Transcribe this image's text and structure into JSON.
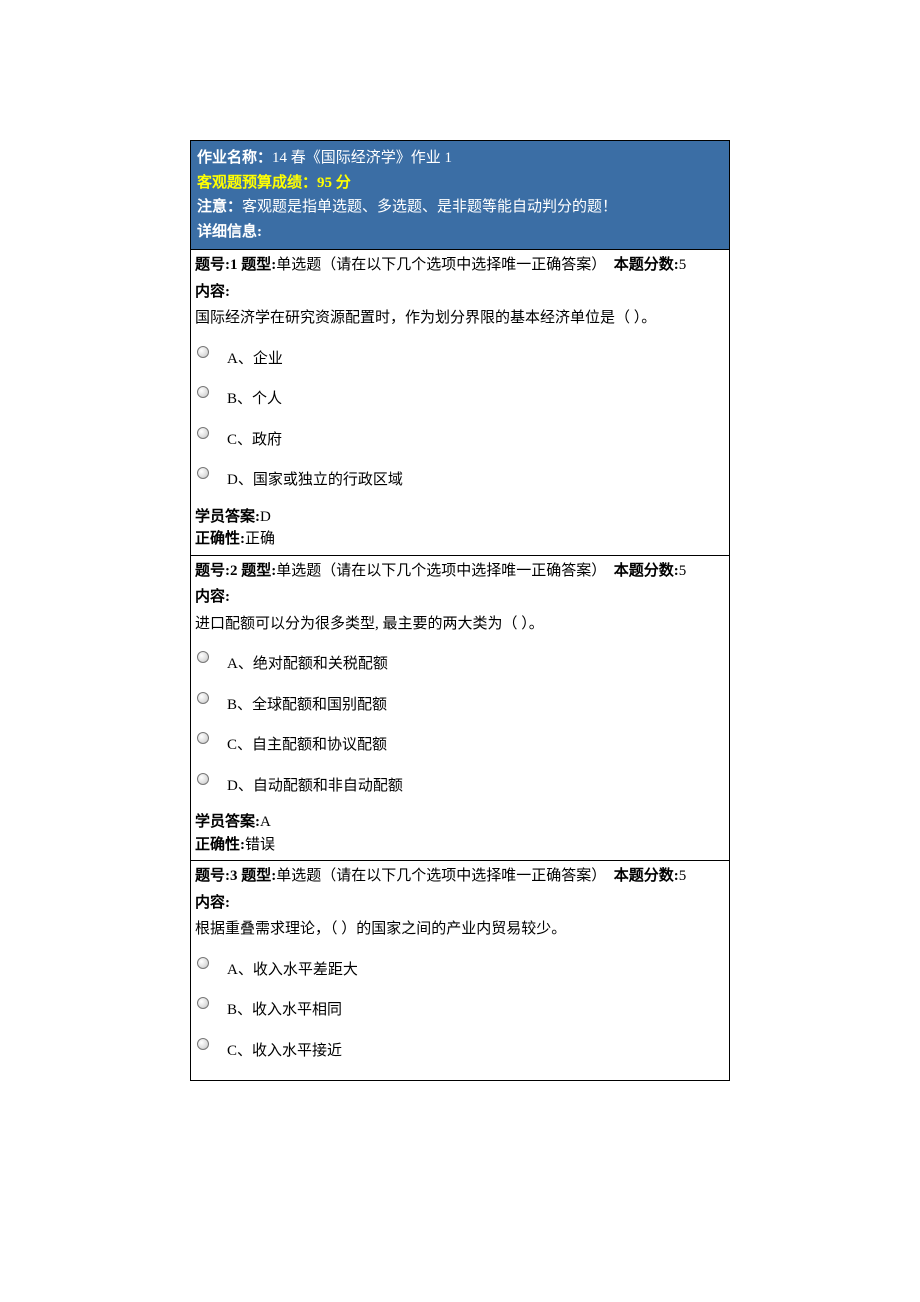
{
  "header": {
    "title_label": "作业名称：",
    "title_value": "14 春《国际经济学》作业 1",
    "score_label": "客观题预算成绩：",
    "score_value": "95 分",
    "note_label": "注意：",
    "note_value": "客观题是指单选题、多选题、是非题等能自动判分的题！",
    "detail_label": "详细信息:"
  },
  "labels": {
    "q_num": "题号:",
    "q_type": "题型:",
    "q_score": "本题分数:",
    "content": "内容:",
    "student_answer": "学员答案:",
    "correctness": "正确性:"
  },
  "questions": [
    {
      "num": "1",
      "type": "单选题（请在以下几个选项中选择唯一正确答案）",
      "score": "5",
      "text": "国际经济学在研究资源配置时，作为划分界限的基本经济单位是（ ）。",
      "options": [
        "A、企业",
        "B、个人",
        "C、政府",
        "D、国家或独立的行政区域"
      ],
      "answer": "D",
      "correct": "正确"
    },
    {
      "num": "2",
      "type": "单选题（请在以下几个选项中选择唯一正确答案）",
      "score": "5",
      "text": "进口配额可以分为很多类型, 最主要的两大类为（ ）。",
      "options": [
        "A、绝对配额和关税配额",
        "B、全球配额和国别配额",
        "C、自主配额和协议配额",
        "D、自动配额和非自动配额"
      ],
      "answer": "A",
      "correct": "错误"
    },
    {
      "num": "3",
      "type": "单选题（请在以下几个选项中选择唯一正确答案）",
      "score": "5",
      "text": "根据重叠需求理论，（  ）的国家之间的产业内贸易较少。",
      "options": [
        "A、收入水平差距大",
        "B、收入水平相同",
        "C、收入水平接近"
      ],
      "answer": "",
      "correct": ""
    }
  ]
}
